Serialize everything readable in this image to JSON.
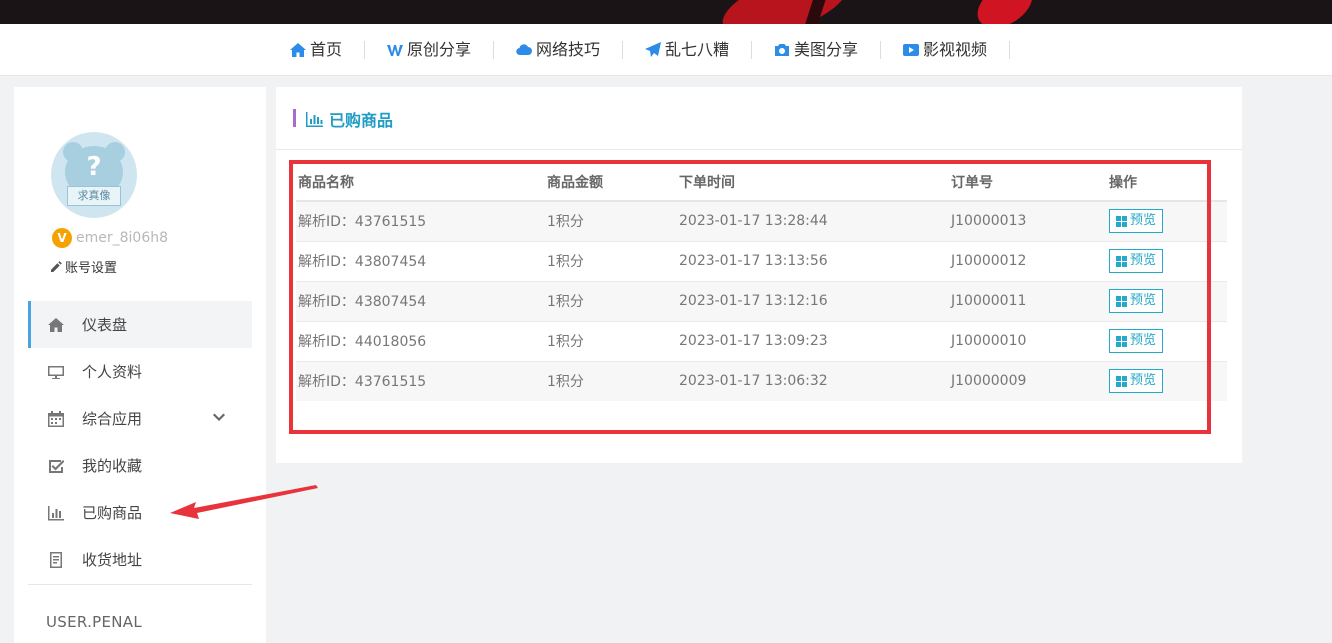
{
  "nav": {
    "items": [
      {
        "label": "首页",
        "icon": "home-icon"
      },
      {
        "label": "原创分享",
        "icon": "w-logo-icon"
      },
      {
        "label": "网络技巧",
        "icon": "cloud-icon"
      },
      {
        "label": "乱七八糟",
        "icon": "paper-plane-icon"
      },
      {
        "label": "美图分享",
        "icon": "camera-icon"
      },
      {
        "label": "影视视频",
        "icon": "video-play-icon"
      }
    ]
  },
  "sidebar": {
    "avatar_text": "求真像",
    "avatar_mark": "?",
    "vip_badge": "V",
    "username": "emer_8i06h8",
    "account_settings": "账号设置",
    "menu": [
      {
        "label": "仪表盘",
        "icon": "home-icon",
        "active": true
      },
      {
        "label": "个人资料",
        "icon": "monitor-icon"
      },
      {
        "label": "综合应用",
        "icon": "calendar-icon",
        "expandable": true
      },
      {
        "label": "我的收藏",
        "icon": "checkbox-icon"
      },
      {
        "label": "已购商品",
        "icon": "bar-chart-icon"
      },
      {
        "label": "收货地址",
        "icon": "address-book-icon"
      }
    ],
    "footer_label": "USER.PENAL"
  },
  "panel": {
    "title": "已购商品",
    "columns": [
      "商品名称",
      "商品金额",
      "下单时间",
      "订单号",
      "操作"
    ],
    "rows": [
      {
        "name": "解析ID：43761515",
        "amount": "1积分",
        "time": "2023-01-17 13:28:44",
        "order": "J10000013",
        "action": "预览"
      },
      {
        "name": "解析ID：43807454",
        "amount": "1积分",
        "time": "2023-01-17 13:13:56",
        "order": "J10000012",
        "action": "预览"
      },
      {
        "name": "解析ID：43807454",
        "amount": "1积分",
        "time": "2023-01-17 13:12:16",
        "order": "J10000011",
        "action": "预览"
      },
      {
        "name": "解析ID：44018056",
        "amount": "1积分",
        "time": "2023-01-17 13:09:23",
        "order": "J10000010",
        "action": "预览"
      },
      {
        "name": "解析ID：43761515",
        "amount": "1积分",
        "time": "2023-01-17 13:06:32",
        "order": "J10000009",
        "action": "预览"
      }
    ]
  },
  "colors": {
    "accent": "#2d8ce8",
    "title": "#1f9dc4",
    "annotation": "#e8333b",
    "active_marker": "#4aa3df"
  }
}
